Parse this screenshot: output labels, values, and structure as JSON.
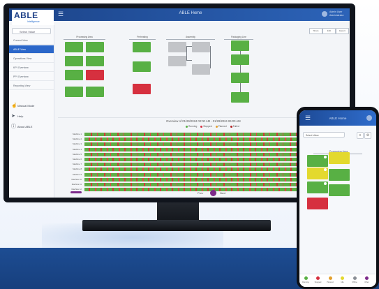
{
  "app": {
    "title": "ABLE Home",
    "logo_text": "ABLE",
    "logo_sub": "Intelligence",
    "user_name": "Admin User",
    "user_role": "Administrator"
  },
  "sidebar": {
    "select_label": "Select Value",
    "items": [
      {
        "label": "Current View",
        "active": false
      },
      {
        "label": "ABLE View",
        "active": true
      },
      {
        "label": "Operations View",
        "active": false
      },
      {
        "label": "KPI Overview",
        "active": false
      },
      {
        "label": "PPI Overview",
        "active": false
      },
      {
        "label": "Reporting View",
        "active": false
      }
    ],
    "tools": [
      {
        "label": "Manual Mode",
        "icon": "hand-icon"
      },
      {
        "label": "Help",
        "icon": "pointer-icon"
      },
      {
        "label": "About ABLE",
        "icon": "info-icon"
      }
    ]
  },
  "toolbar": {
    "buttons": [
      "Share",
      "Edit",
      "Export"
    ]
  },
  "flow": {
    "groups": [
      "Processing Area",
      "Preheating",
      "Assembly",
      "Packaging Line"
    ],
    "colors": {
      "green": "#58b044",
      "red": "#d6303f",
      "gray": "#c2c4c8"
    }
  },
  "gantt": {
    "title": "Overview of 01/29/2024 00:00 AM - 01/29/2024 06:00 AM",
    "legend": [
      {
        "label": "Running",
        "color": "#58b044"
      },
      {
        "label": "Stopped",
        "color": "#d6303f"
      },
      {
        "label": "Planned",
        "color": "#e3a02e"
      },
      {
        "label": "Failed",
        "color": "#b22222"
      }
    ],
    "rows": [
      "Machine 1",
      "Machine 2",
      "Machine 3",
      "Machine 4",
      "Machine 5",
      "Machine 6",
      "Machine 7",
      "Machine 8",
      "Machine 9",
      "Machine 10",
      "Machine 11",
      "Machine 12"
    ],
    "controls": [
      "Prev",
      "Next"
    ]
  },
  "phone": {
    "title": "ABLE Home",
    "select_label": "Select Value",
    "group": "Processing Area",
    "tabs": [
      {
        "label": "Running",
        "color": "#58b044"
      },
      {
        "label": "Stopped",
        "color": "#d6303f"
      },
      {
        "label": "Planned",
        "color": "#e3a02e"
      },
      {
        "label": "Idle",
        "color": "#e3d92e"
      },
      {
        "label": "Offline",
        "color": "#8a8f96"
      },
      {
        "label": "Other",
        "color": "#7c2a8a"
      }
    ]
  }
}
